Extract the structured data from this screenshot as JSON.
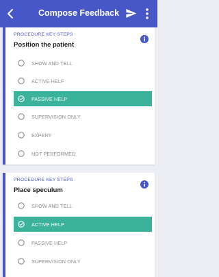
{
  "appbar": {
    "title": "Compose Feedback",
    "back_icon": "chevron-left-icon",
    "send_icon": "send-icon",
    "more_icon": "more-vert-icon"
  },
  "colors": {
    "primary": "#4757c8",
    "selected": "#3bb39a",
    "background": "#eceef3"
  },
  "steps": [
    {
      "overline": "PROCEDURE KEY STEPS",
      "title": "Position the patient",
      "options": [
        {
          "label": "SHOW AND TELL",
          "selected": false
        },
        {
          "label": "ACTIVE HELP",
          "selected": false
        },
        {
          "label": "PASSIVE HELP",
          "selected": true
        },
        {
          "label": "SUPERVISION ONLY",
          "selected": false
        },
        {
          "label": "EXPERT",
          "selected": false
        },
        {
          "label": "NOT PERFORMED",
          "selected": false
        }
      ]
    },
    {
      "overline": "PROCEDURE KEY STEPS",
      "title": "Place speculum",
      "options": [
        {
          "label": "SHOW AND TELL",
          "selected": false
        },
        {
          "label": "ACTIVE HELP",
          "selected": true
        },
        {
          "label": "PASSIVE HELP",
          "selected": false
        },
        {
          "label": "SUPERVISION ONLY",
          "selected": false
        }
      ]
    }
  ]
}
